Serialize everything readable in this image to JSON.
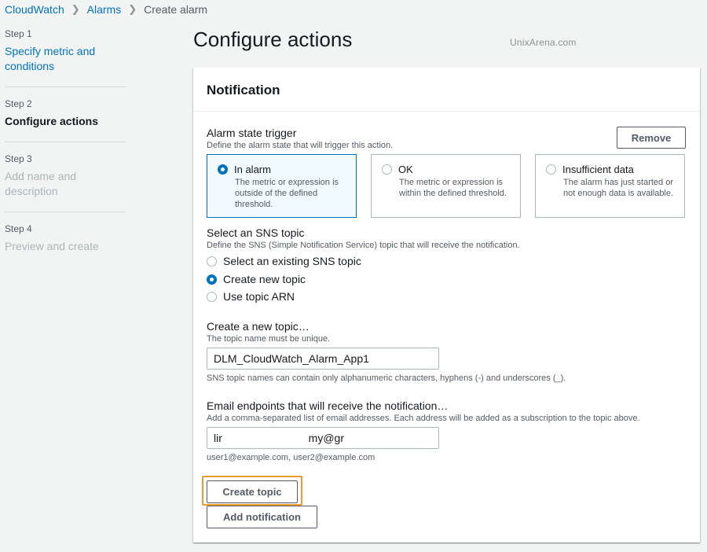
{
  "breadcrumb": {
    "items": [
      "CloudWatch",
      "Alarms"
    ],
    "current": "Create alarm"
  },
  "sidebar": {
    "steps": [
      {
        "num": "Step 1",
        "title": "Specify metric and conditions",
        "state": "link"
      },
      {
        "num": "Step 2",
        "title": "Configure actions",
        "state": "active"
      },
      {
        "num": "Step 3",
        "title": "Add name and description",
        "state": "disabled"
      },
      {
        "num": "Step 4",
        "title": "Preview and create",
        "state": "disabled"
      }
    ]
  },
  "page": {
    "title": "Configure actions",
    "watermark": "UnixArena.com"
  },
  "notification": {
    "header": "Notification",
    "remove_label": "Remove",
    "alarm_state": {
      "label": "Alarm state trigger",
      "desc": "Define the alarm state that will trigger this action.",
      "options": [
        {
          "title": "In alarm",
          "text": "The metric or expression is outside of the defined threshold.",
          "selected": true
        },
        {
          "title": "OK",
          "text": "The metric or expression is within the defined threshold.",
          "selected": false
        },
        {
          "title": "Insufficient data",
          "text": "The alarm has just started or not enough data is available.",
          "selected": false
        }
      ]
    },
    "sns": {
      "label": "Select an SNS topic",
      "desc": "Define the SNS (Simple Notification Service) topic that will receive the notification.",
      "options": [
        {
          "label": "Select an existing SNS topic",
          "selected": false
        },
        {
          "label": "Create new topic",
          "selected": true
        },
        {
          "label": "Use topic ARN",
          "selected": false
        }
      ]
    },
    "new_topic": {
      "label": "Create a new topic…",
      "desc": "The topic name must be unique.",
      "value": "DLM_CloudWatch_Alarm_App1",
      "hint": "SNS topic names can contain only alphanumeric characters, hyphens (-) and underscores (_)."
    },
    "email": {
      "label": "Email endpoints that will receive the notification…",
      "desc": "Add a comma-separated list of email addresses. Each address will be added as a subscription to the topic above.",
      "value_start": "lir",
      "value_end": "my@gr",
      "hint": "user1@example.com, user2@example.com"
    },
    "create_topic_label": "Create topic",
    "add_notification_label": "Add notification"
  },
  "colors": {
    "link": "#0073bb",
    "highlight": "#ec9c2f",
    "selected_tile_bg": "#f1faff"
  }
}
